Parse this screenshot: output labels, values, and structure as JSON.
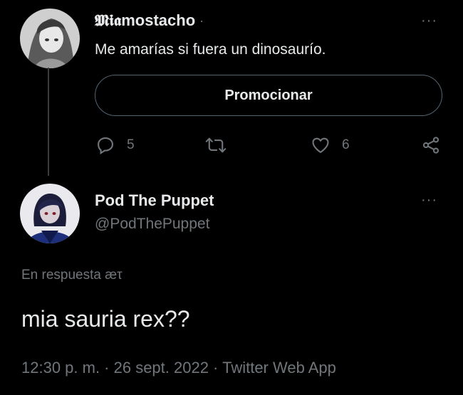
{
  "tweet1": {
    "display_name": "𝕸𝖎𝖆mostacho",
    "separator": "·",
    "text": "Me amarías si fuera un dinosaurío.",
    "more": "···",
    "promote_label": "Promocionar",
    "reply_count": "5",
    "retweet_count": "",
    "like_count": "6"
  },
  "tweet2": {
    "display_name": "Pod The Puppet",
    "handle": "@PodThePuppet",
    "more": "···",
    "reply_to": "En respuesta æτ",
    "text": "mia sauria rex??",
    "timestamp": "12:30 p. m. · 26 sept. 2022 · Twitter Web App"
  },
  "colors": {
    "background": "#000000",
    "text": "#e7e9ea",
    "muted": "#71767b",
    "border": "#536471"
  },
  "icons": {
    "reply": "reply-icon",
    "retweet": "retweet-icon",
    "like": "heart-icon",
    "share": "share-icon",
    "more": "more-dots-icon"
  }
}
